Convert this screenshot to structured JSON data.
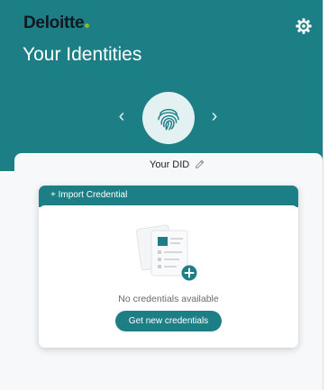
{
  "brand": {
    "name": "Deloitte",
    "dot_color": "#86bc25"
  },
  "header": {
    "title": "Your Identities",
    "settings_icon": "gear-icon",
    "background": "#1d7f86"
  },
  "identity": {
    "avatar_icon": "fingerprint-icon",
    "prev_icon": "chevron-left-icon",
    "next_icon": "chevron-right-icon",
    "prev_glyph": "‹",
    "next_glyph": "›",
    "did_label": "Your DID",
    "edit_icon": "pencil-icon"
  },
  "credentials": {
    "import_label": "+ Import Credential",
    "empty_icon": "documents-add-icon",
    "empty_message": "No credentials available",
    "cta_label": "Get new credentials"
  },
  "colors": {
    "accent": "#1d7f86",
    "accent_light": "#e3f1f2",
    "text_muted": "#6b6b6b"
  }
}
